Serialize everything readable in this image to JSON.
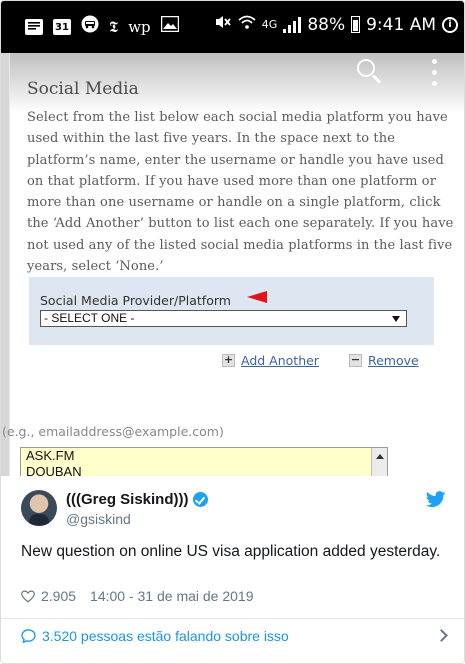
{
  "status_bar": {
    "left_icons": [
      "message-icon",
      "calendar-icon",
      "car-icon",
      "nyt-icon",
      "wp-icon",
      "image-icon"
    ],
    "calendar_day": "31",
    "nyt_glyph": "𝕿",
    "wp_glyph": "wp",
    "network": "4G",
    "battery": "88%",
    "time": "9:41 AM"
  },
  "form": {
    "title": "Social Media",
    "description": "Select from the list below each social media platform you have used within the last five years. In the space next to the platform’s name, enter the username or handle you have used on that platform. If you have used more than one platform or more than one username or handle on a single platform, click the ‘Add Another’ button to list each one separately. If you have not used any of the listed social media platforms in the last five years, select ‘None.’",
    "provider_label": "Social Media Provider/Platform",
    "select_value": "- SELECT ONE -",
    "add_another": "Add Another",
    "remove": "Remove",
    "email_hint": "(e.g., emailaddress@example.com)",
    "list_options": [
      "ASK.FM",
      "DOUBAN"
    ]
  },
  "tweet": {
    "display_name": "(((Greg Siskind)))",
    "handle": "@gsiskind",
    "text": "New question on online US visa application added yesterday.",
    "likes": "2.905",
    "timestamp": "14:00 - 31 de mai de 2019",
    "conversation": "3.520 pessoas estão falando sobre isso"
  },
  "colors": {
    "twitter_blue": "#1da1f2",
    "link_blue": "#1b95e0",
    "red_arrow": "#e0141c",
    "provider_bg": "#dde6f1",
    "listbox_bg": "#ffffcc"
  }
}
